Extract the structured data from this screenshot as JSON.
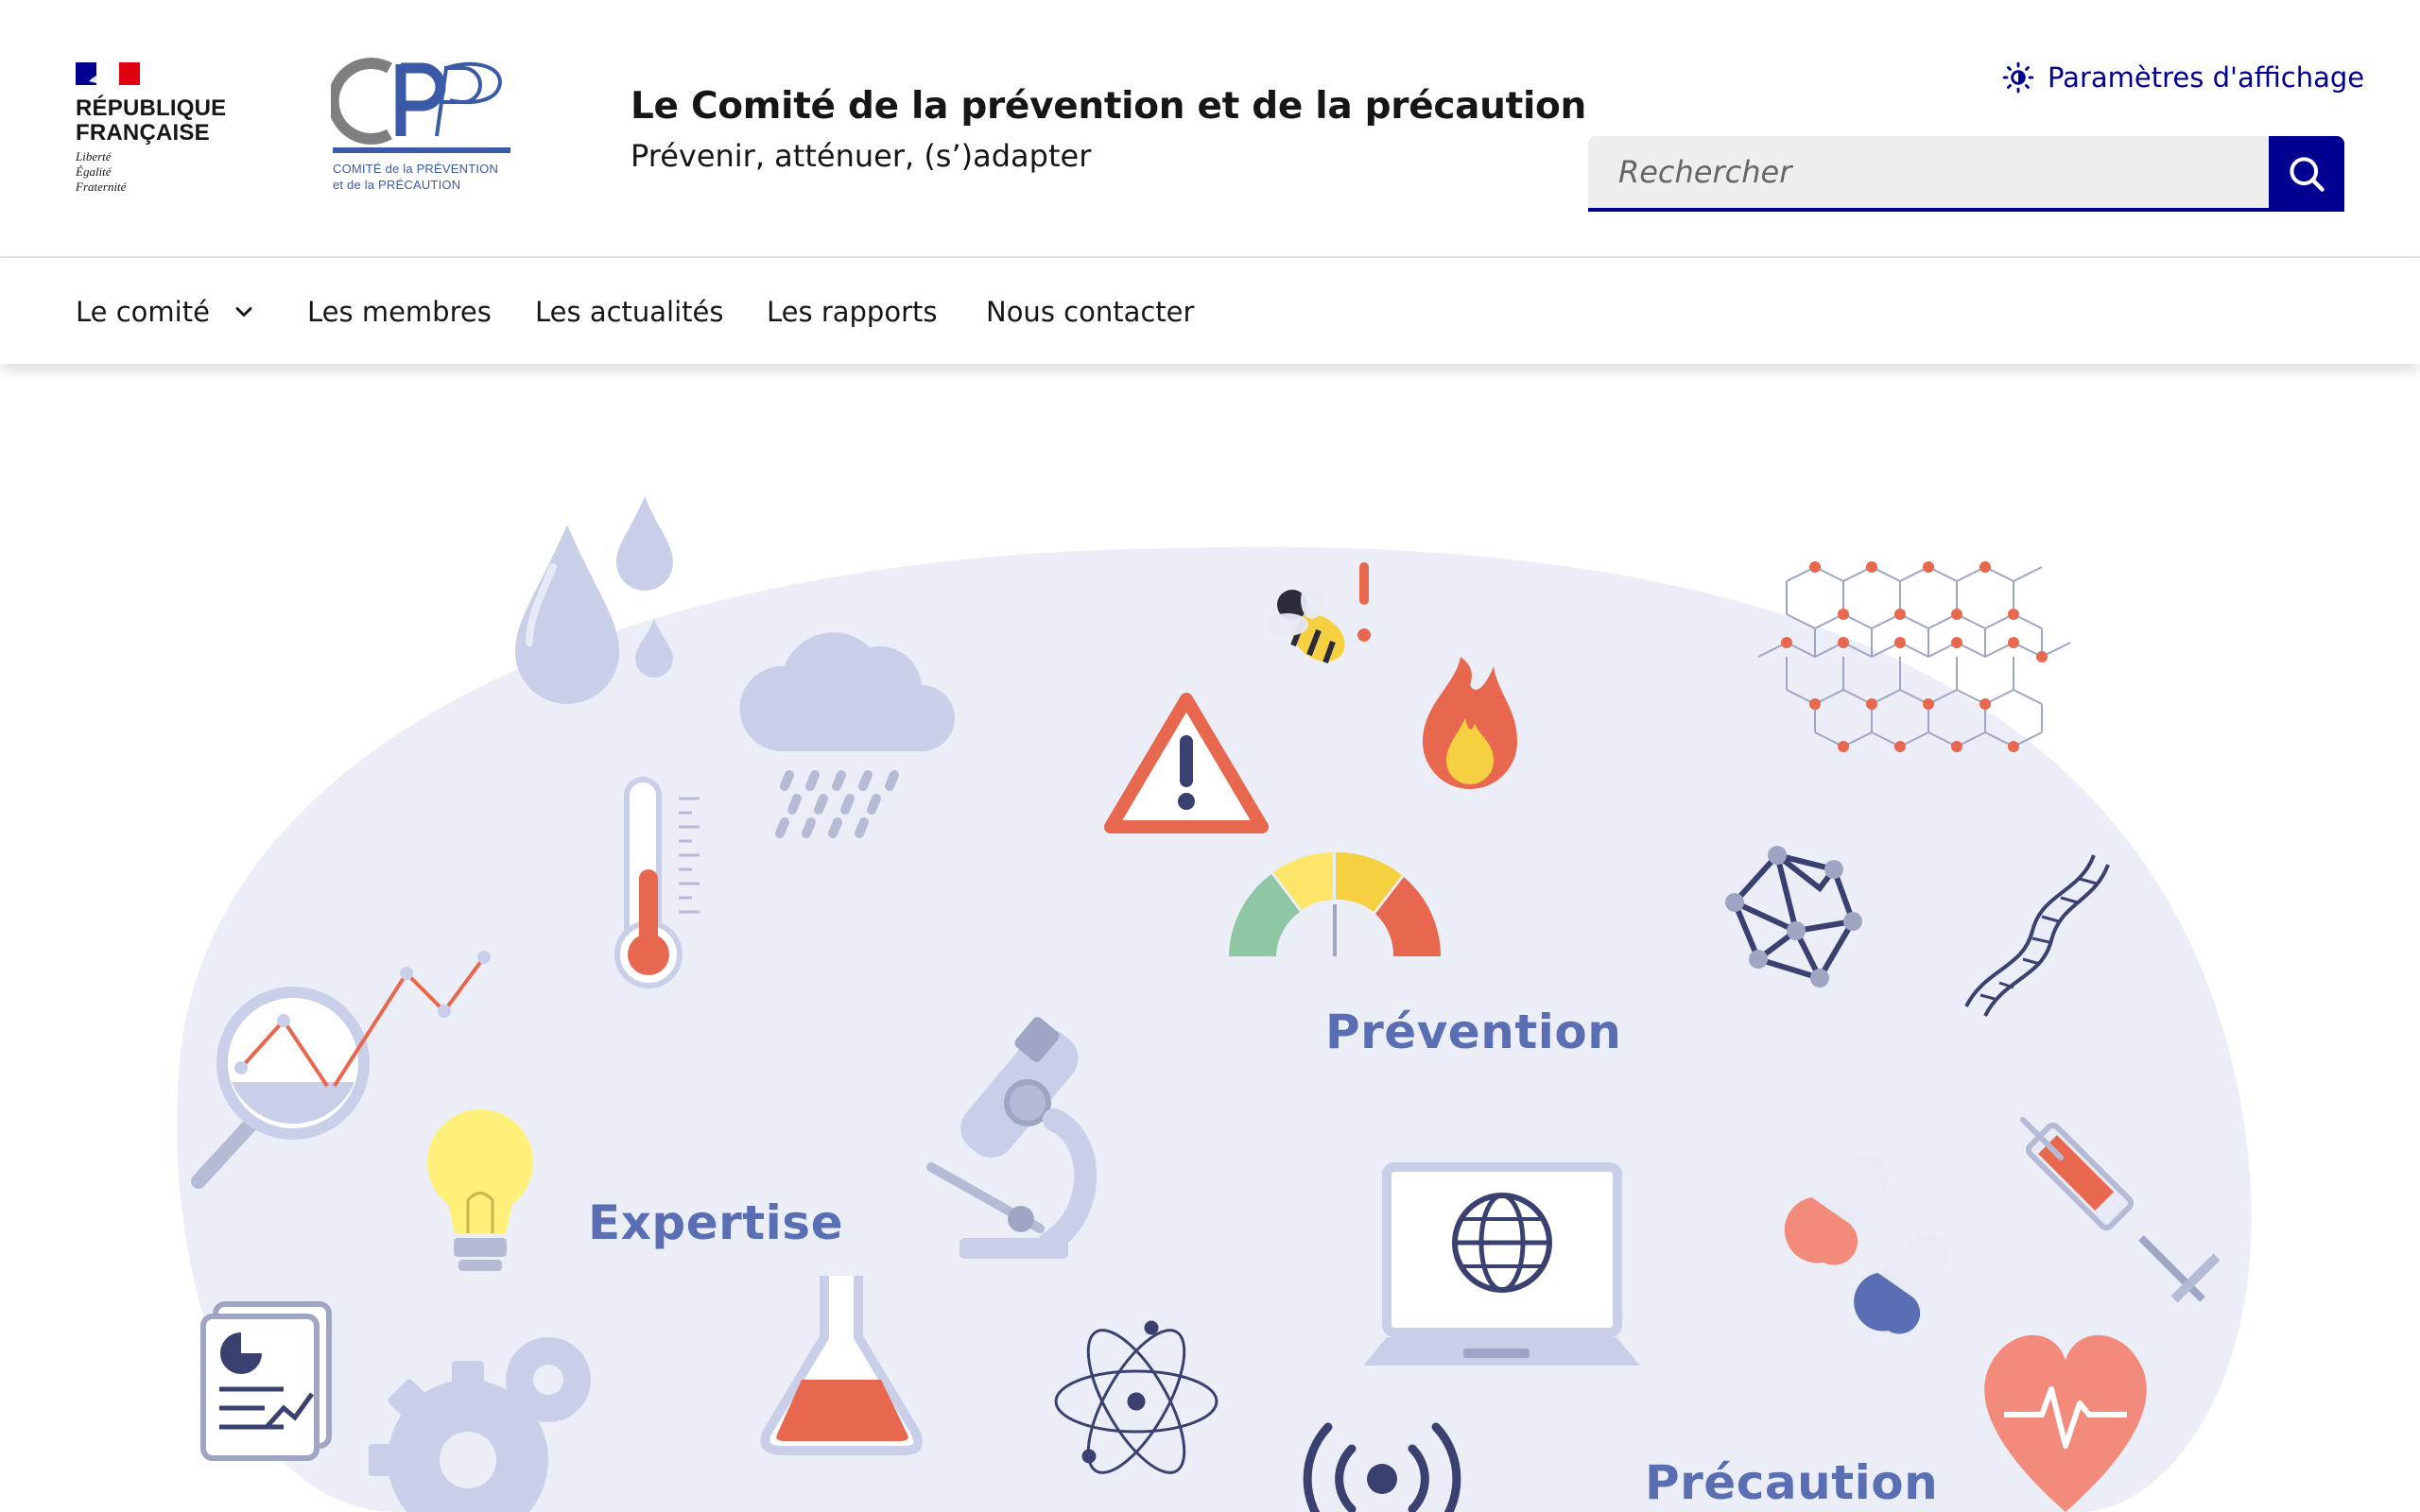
{
  "header": {
    "republic": {
      "line1": "RÉPUBLIQUE",
      "line2": "FRANÇAISE",
      "motto1": "Liberté",
      "motto2": "Égalité",
      "motto3": "Fraternité"
    },
    "cpp_logo": {
      "letters": "CPP",
      "sub1": "COMITÉ de la PRÉVENTION",
      "sub2": "et de la PRÉCAUTION"
    },
    "title": "Le Comité de la prévention et de la précaution",
    "tagline": "Prévenir, atténuer, (s’)adapter",
    "display_settings": "Paramètres d'affichage",
    "search": {
      "placeholder": "Rechercher",
      "value": ""
    }
  },
  "nav": {
    "items": [
      {
        "label": "Le comité",
        "has_dropdown": true
      },
      {
        "label": "Les membres"
      },
      {
        "label": "Les actualités"
      },
      {
        "label": "Les rapports"
      },
      {
        "label": "Nous contacter"
      }
    ]
  },
  "hero": {
    "labels": {
      "prevention": "Prévention",
      "expertise": "Expertise",
      "precaution": "Précaution"
    },
    "icons": [
      "water-drops-icon",
      "rain-cloud-icon",
      "thermometer-icon",
      "magnifier-chart-icon",
      "lightbulb-icon",
      "microscope-icon",
      "warning-icon",
      "bee-alert-icon",
      "fire-icon",
      "gauge-icon",
      "molecule-grid-icon",
      "polyhedron-icon",
      "dna-icon",
      "laptop-globe-icon",
      "pills-icon",
      "syringe-icon",
      "flask-icon",
      "atom-icon",
      "report-icon",
      "gears-icon",
      "antenna-icon",
      "heart-pulse-icon"
    ]
  },
  "colors": {
    "accent": "#000091",
    "label": "#5a6fb3",
    "blob": "#eceef7",
    "orange": "#e8684f"
  }
}
